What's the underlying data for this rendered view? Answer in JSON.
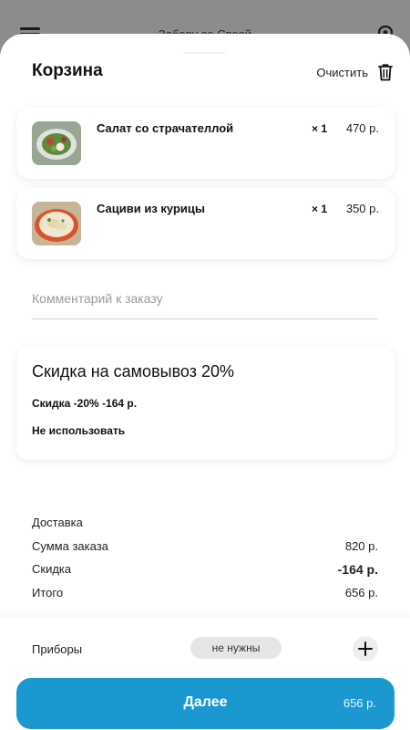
{
  "background": {
    "title": "Заберу со Своей"
  },
  "cart": {
    "title": "Корзина",
    "clear_label": "Очистить",
    "items": [
      {
        "name": "Салат со страчателлой",
        "qty": "× 1",
        "price": "470 р.",
        "thumb_icon": "salad-dish-icon"
      },
      {
        "name": "Сациви из курицы",
        "qty": "× 1",
        "price": "350 р.",
        "thumb_icon": "satsivi-dish-icon"
      }
    ]
  },
  "comment": {
    "placeholder": "Комментарий к заказу",
    "value": ""
  },
  "promo": {
    "title": "Скидка на самовывоз 20%",
    "detail": "Скидка -20% -164 р.",
    "dismiss_label": "Не использовать"
  },
  "summary": {
    "delivery_label": "Доставка",
    "delivery_value": "",
    "order_sum_label": "Сумма заказа",
    "order_sum_value": "820 р.",
    "discount_label": "Скидка",
    "discount_value": "-164 р.",
    "total_label": "Итого",
    "total_value": "656 р."
  },
  "cutlery": {
    "label": "Приборы",
    "value": "не нужны"
  },
  "checkout": {
    "button_label": "Далее",
    "total": "656 р."
  },
  "colors": {
    "accent": "#1b98d0",
    "pill": "#e6e6e6"
  }
}
